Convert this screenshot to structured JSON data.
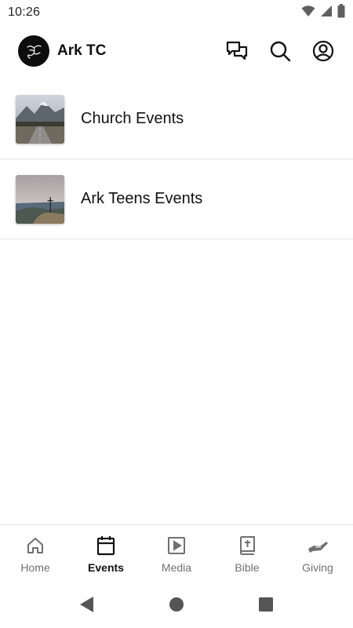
{
  "status_bar": {
    "time": "10:26",
    "icons": [
      "wifi-icon",
      "cell-signal-icon",
      "battery-icon"
    ]
  },
  "app_bar": {
    "title": "Ark TC",
    "logo_icon": "dove-icon",
    "actions": [
      "chat-icon",
      "search-icon",
      "account-icon"
    ]
  },
  "event_lists": [
    {
      "label": "Church Events",
      "thumbnail": "mountain-road-image"
    },
    {
      "label": "Ark Teens Events",
      "thumbnail": "hilltop-cross-image"
    }
  ],
  "bottom_nav": {
    "active": "Events",
    "items": [
      {
        "label": "Home",
        "icon": "home-icon"
      },
      {
        "label": "Events",
        "icon": "calendar-icon"
      },
      {
        "label": "Media",
        "icon": "media-play-icon"
      },
      {
        "label": "Bible",
        "icon": "bible-icon"
      },
      {
        "label": "Giving",
        "icon": "giving-hand-icon"
      }
    ]
  },
  "colors": {
    "active": "#111111",
    "inactive": "#707070",
    "divider": "#e6e6e6",
    "logo_bg": "#0d0d0d"
  },
  "system_nav": [
    "back-icon",
    "home-circle-icon",
    "recents-icon"
  ]
}
